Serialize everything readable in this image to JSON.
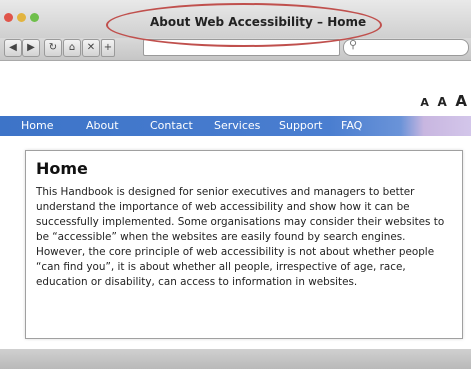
{
  "window": {
    "title": "About Web Accessibility – Home"
  },
  "toolbar": {
    "url_value": "",
    "search_value": ""
  },
  "text_size": [
    "A",
    "A",
    "A"
  ],
  "nav": {
    "items": [
      "Home",
      "About",
      "Contact",
      "Services",
      "Support",
      "FAQ"
    ]
  },
  "main": {
    "heading": "Home",
    "body": "This Handbook is designed for senior executives and managers to better understand the importance of web accessibility and show how it can be successfully implemented. Some organisations may consider their websites to be “accessible” when the websites are easily found by search engines. However, the core principle of web accessibility is not about whether people “can find you”, it is about whether all people, irrespective of age, race, education or disability, can access to information in websites."
  },
  "colors": {
    "nav_blue": "#3d74c8",
    "highlight_ellipse": "#c0504d"
  }
}
